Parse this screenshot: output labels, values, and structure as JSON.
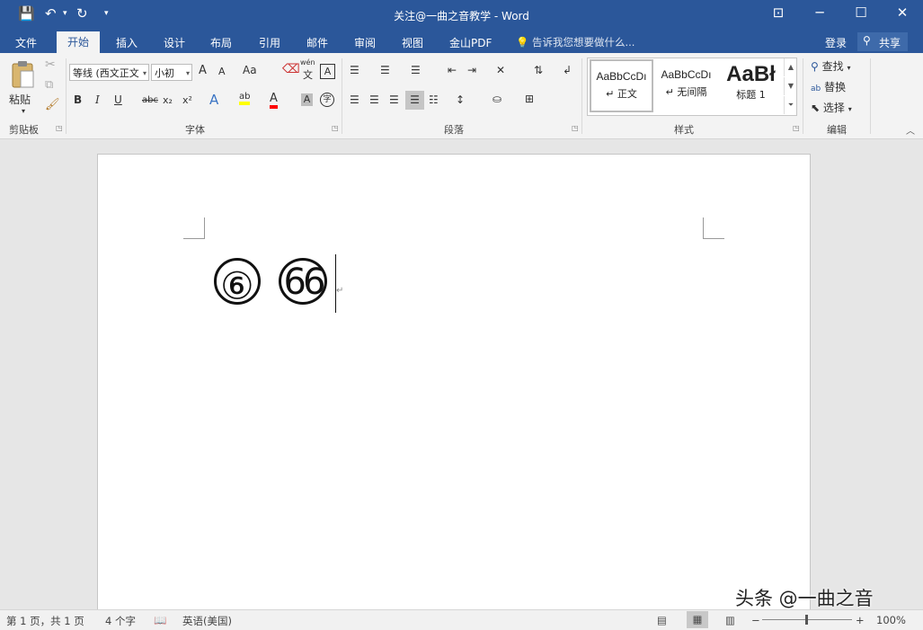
{
  "window": {
    "title": "关注@一曲之音教学 - Word",
    "qat": {
      "save_icon": "💾",
      "undo_icon": "↶",
      "redo_icon": "↻",
      "more_icon": "▾"
    },
    "controls": {
      "ribbon_display": "⊡",
      "minimize": "─",
      "maximize": "☐",
      "close": "✕"
    }
  },
  "tabs": [
    "文件",
    "开始",
    "插入",
    "设计",
    "布局",
    "引用",
    "邮件",
    "审阅",
    "视图",
    "金山PDF"
  ],
  "active_tab": "开始",
  "tell_me": "告诉我您想要做什么...",
  "login": "登录",
  "share": "共享",
  "clipboard": {
    "paste": "粘贴",
    "group": "剪贴板"
  },
  "font": {
    "name": "等线 (西文正文",
    "size": "小初",
    "group": "字体",
    "grow": "A",
    "shrink": "A",
    "case": "Aa",
    "pinyin_top": "wén",
    "pinyin_bottom": "文",
    "border_char": "A",
    "bold": "B",
    "italic": "I",
    "underline": "U",
    "strike": "abc",
    "subscript": "x₂",
    "superscript": "x²",
    "effects": "A",
    "highlight": "ab",
    "color": "A",
    "shading": "A",
    "enclose": "字"
  },
  "paragraph": {
    "group": "段落"
  },
  "styles": {
    "group": "样式",
    "items": [
      {
        "preview": "AaBbCcDı",
        "name": "↵ 正文"
      },
      {
        "preview": "AaBbCcDı",
        "name": "↵ 无间隔"
      },
      {
        "preview": "AaBł",
        "name": "标题 1"
      }
    ]
  },
  "editing": {
    "find": "查找",
    "replace": "替换",
    "select": "选择",
    "group": "编辑"
  },
  "document": {
    "chars": [
      "⑥",
      "66"
    ],
    "para_mark": "↵"
  },
  "status": {
    "page": "第 1 页，共 1 页",
    "words": "4 个字",
    "language": "英语(美国)",
    "zoom": "100%",
    "zoom_minus": "−",
    "zoom_plus": "+"
  },
  "watermark": "头条 @一曲之音",
  "colors": {
    "accent": "#2b579a",
    "highlight": "#ffff00",
    "font_color": "#ff0000"
  }
}
